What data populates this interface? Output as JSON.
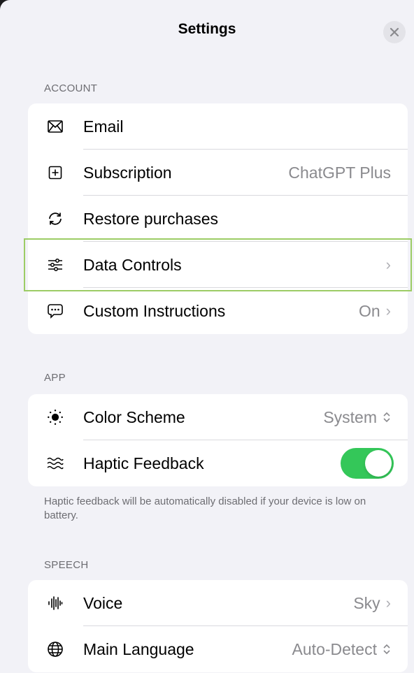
{
  "header": {
    "title": "Settings",
    "close_icon": "close-icon"
  },
  "account": {
    "section_label": "ACCOUNT",
    "items": [
      {
        "icon": "envelope-icon",
        "label": "Email",
        "value": ""
      },
      {
        "icon": "plus-square-icon",
        "label": "Subscription",
        "value": "ChatGPT Plus"
      },
      {
        "icon": "refresh-icon",
        "label": "Restore purchases",
        "value": ""
      },
      {
        "icon": "sliders-icon",
        "label": "Data Controls",
        "value": ""
      },
      {
        "icon": "chat-bubble-icon",
        "label": "Custom Instructions",
        "value": "On"
      }
    ]
  },
  "app": {
    "section_label": "APP",
    "items": [
      {
        "icon": "sun-icon",
        "label": "Color Scheme",
        "value": "System"
      },
      {
        "icon": "waves-icon",
        "label": "Haptic Feedback",
        "toggle_on": true
      }
    ],
    "footnote": "Haptic feedback will be automatically disabled if your device is low on battery."
  },
  "speech": {
    "section_label": "SPEECH",
    "items": [
      {
        "icon": "waveform-icon",
        "label": "Voice",
        "value": "Sky"
      },
      {
        "icon": "globe-icon",
        "label": "Main Language",
        "value": "Auto-Detect"
      }
    ]
  },
  "colors": {
    "toggle_on": "#34c759",
    "highlight_border": "#9ccc65",
    "background": "#f2f2f7"
  }
}
